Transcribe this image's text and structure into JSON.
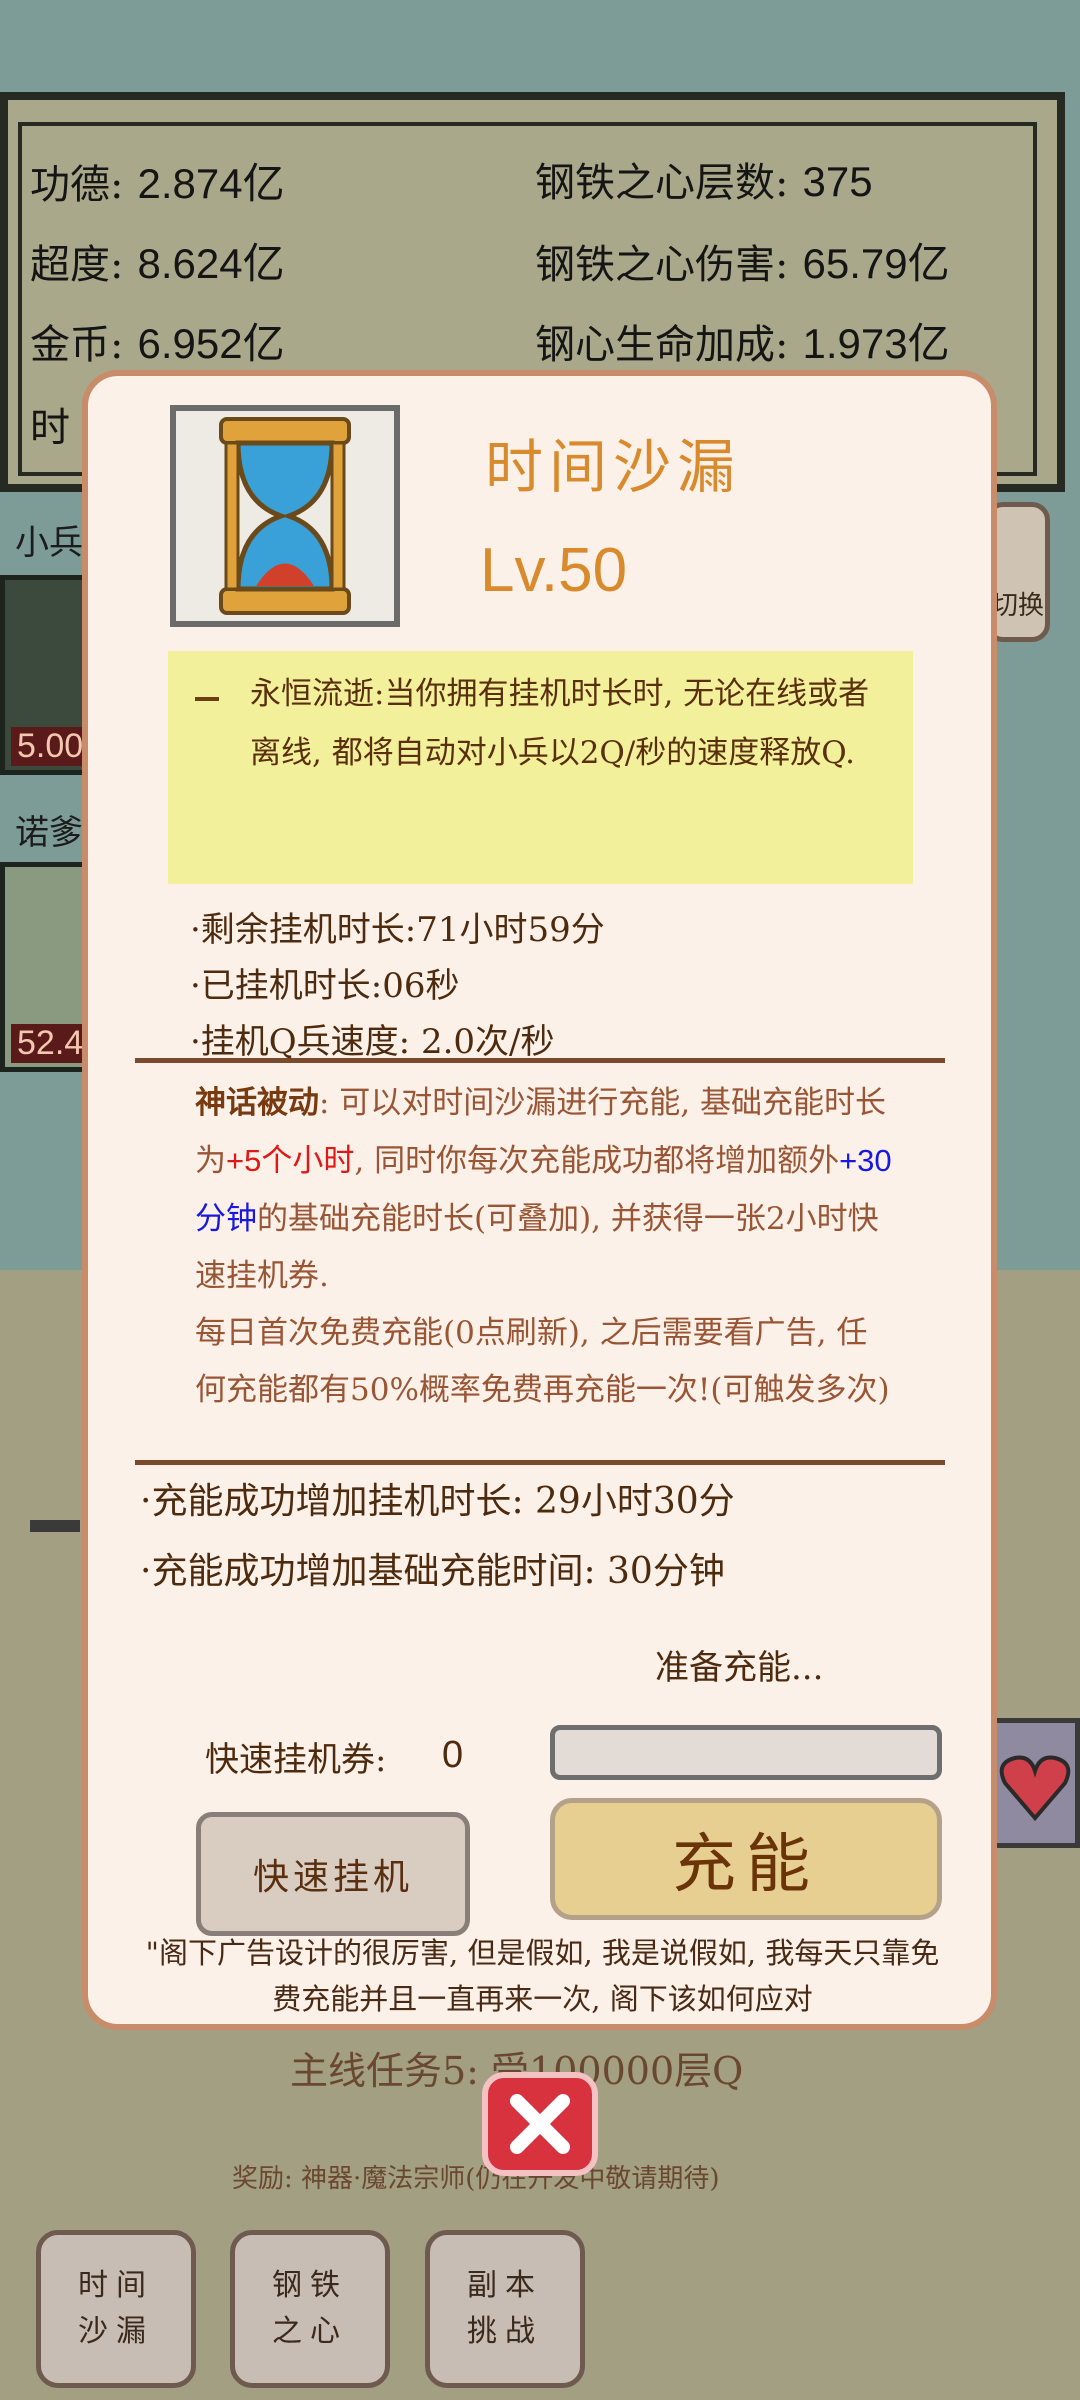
{
  "stats": {
    "merit_label": "功德:",
    "merit_value": "2.874亿",
    "salvation_label": "超度:",
    "salvation_value": "8.624亿",
    "gold_label": "金币:",
    "gold_value": "6.952亿",
    "time_label": "时",
    "iron_layers_label": "钢铁之心层数:",
    "iron_layers_value": "375",
    "iron_damage_label": "钢铁之心伤害:",
    "iron_damage_value": "65.79亿",
    "iron_hp_label": "钢心生命加成:",
    "iron_hp_value": "1.973亿"
  },
  "background": {
    "label_soldier": "小兵",
    "label_nuo": "诺爹",
    "portrait1_value": "5.00",
    "portrait2_value": "52.4",
    "right_button": "切换"
  },
  "item": {
    "title": "时间沙漏",
    "level": "Lv.50",
    "description": "永恒流逝:当你拥有挂机时长时, 无论在线或者离线, 都将自动对小兵以2Q/秒的速度释放Q."
  },
  "info": {
    "remaining": "·剩余挂机时长:71小时59分",
    "elapsed": "·已挂机时长:06秒",
    "speed": "·挂机Q兵速度: 2.0次/秒"
  },
  "myth": {
    "title": "神话被动",
    "p1": ": 可以对时间沙漏进行充能, 基础充能时长为",
    "red": "+5个小时",
    "p2": ", 同时你每次充能成功都将增加额外",
    "blue": "+30分钟",
    "p3": "的基础充能时长(可叠加), 并获得一张2小时快速挂机券.",
    "p4": "每日首次免费充能(0点刷新), 之后需要看广告, 任何充能都有50%概率免费再充能一次!(可触发多次)"
  },
  "gains": {
    "hours": "·充能成功增加挂机时长: 29小时30分",
    "base": "·充能成功增加基础充能时间: 30分钟"
  },
  "ready_text": "准备充能...",
  "ticket": {
    "label": "快速挂机券:",
    "count": "0"
  },
  "progress": 0,
  "buttons": {
    "quick": "快速挂机",
    "charge": "充能"
  },
  "quote": "\"阁下广告设计的很厉害, 但是假如, 我是说假如, 我每天只靠免费充能并且一直再来一次, 阁下该如何应对",
  "quest": "主线任务5: 受100000层Q",
  "reward": "奖励: 神器·魔法宗师(仍在开发中敬请期待)",
  "tabs": [
    "时间沙漏",
    "钢铁之心",
    "副本挑战"
  ],
  "colors": {
    "accent": "#d98a2c",
    "red": "#e01818",
    "blue": "#1818e0"
  }
}
